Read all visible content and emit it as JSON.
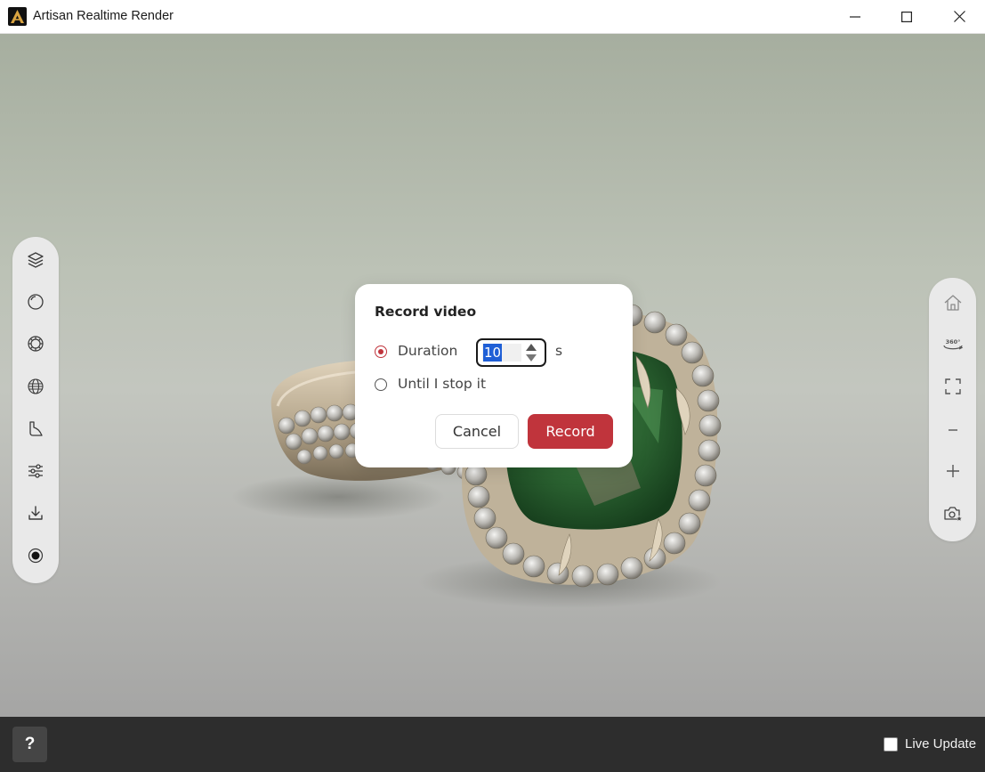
{
  "window": {
    "title": "Artisan Realtime Render"
  },
  "left_toolbar": {
    "items": [
      {
        "icon": "layers-icon"
      },
      {
        "icon": "sphere-icon"
      },
      {
        "icon": "gem-icon"
      },
      {
        "icon": "environment-globe-icon"
      },
      {
        "icon": "backdrop-icon"
      },
      {
        "icon": "sliders-icon"
      },
      {
        "icon": "download-icon"
      },
      {
        "icon": "record-icon"
      }
    ]
  },
  "right_toolbar": {
    "items": [
      {
        "icon": "home-icon"
      },
      {
        "icon": "rotate-360-icon",
        "label": "360°"
      },
      {
        "icon": "fullscreen-icon"
      },
      {
        "icon": "zoom-out-icon"
      },
      {
        "icon": "zoom-in-icon"
      },
      {
        "icon": "camera-star-icon"
      }
    ]
  },
  "dialog": {
    "title": "Record video",
    "option_duration": "Duration",
    "duration_value": "10",
    "duration_unit": "s",
    "option_until": "Until I stop it",
    "selected_option": "duration",
    "cancel_label": "Cancel",
    "record_label": "Record"
  },
  "bottom_bar": {
    "help_label": "?",
    "live_update_label": "Live Update",
    "live_update_checked": false
  },
  "colors": {
    "accent": "#c0343c",
    "selection": "#1f5fd6"
  }
}
